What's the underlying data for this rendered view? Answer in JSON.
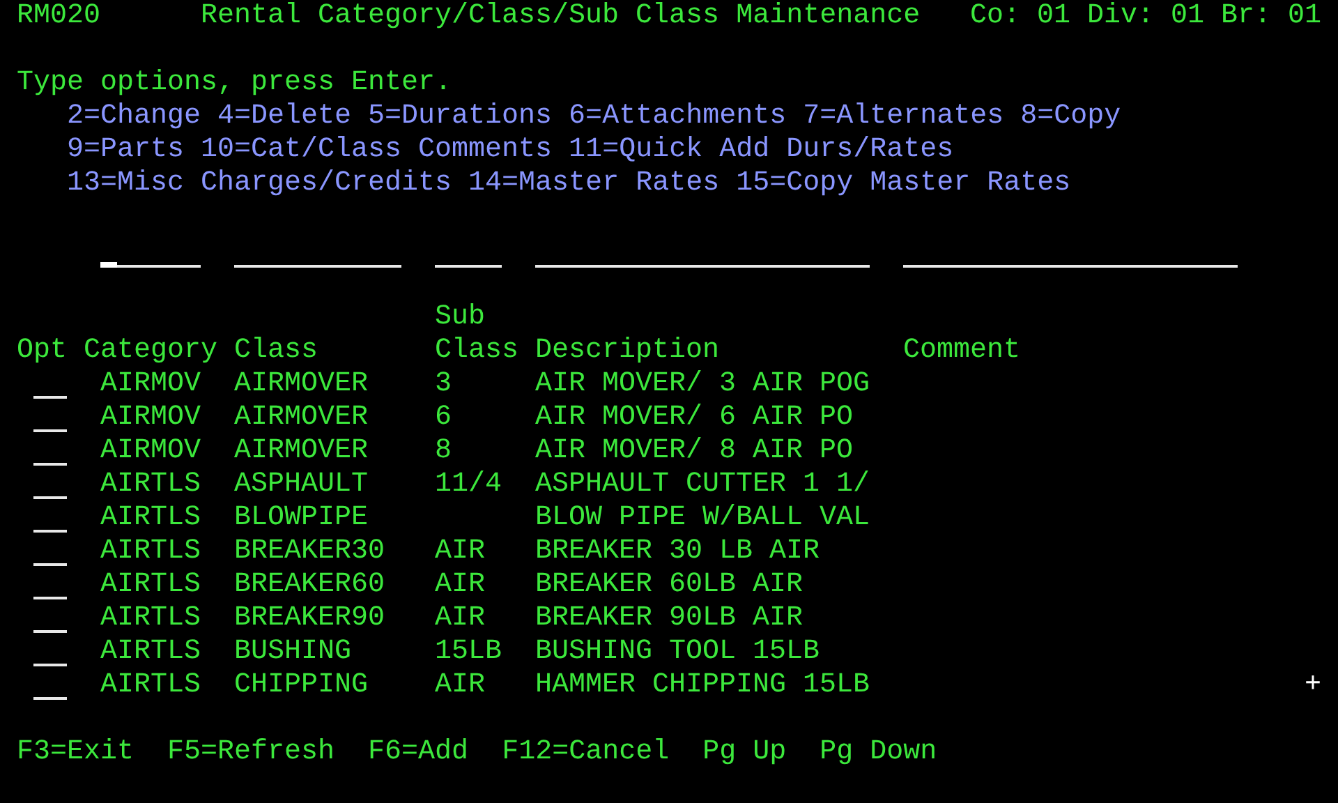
{
  "header": {
    "program": "RM020",
    "title": "Rental Category/Class/Sub Class Maintenance",
    "location": "Co: 01 Div: 01 Br: 01"
  },
  "instructions": "Type options, press Enter.",
  "option_lines": [
    "2=Change 4=Delete 5=Durations 6=Attachments 7=Alternates 8=Copy",
    "9=Parts 10=Cat/Class Comments 11=Quick Add Durs/Rates",
    "13=Misc Charges/Credits 14=Master Rates 15=Copy Master Rates"
  ],
  "filters": [
    {
      "focused": true
    },
    {
      "focused": false
    },
    {
      "focused": false
    },
    {
      "focused": false
    },
    {
      "focused": false
    }
  ],
  "table": {
    "columns": [
      "Opt",
      "Category",
      "Class",
      "Sub Class",
      "Description",
      "Comment"
    ],
    "rows": [
      {
        "category": "AIRMOV",
        "class": "AIRMOVER",
        "sub_class": "3",
        "description": "AIR MOVER/ 3 AIR POG"
      },
      {
        "category": "AIRMOV",
        "class": "AIRMOVER",
        "sub_class": "6",
        "description": "AIR MOVER/ 6 AIR PO"
      },
      {
        "category": "AIRMOV",
        "class": "AIRMOVER",
        "sub_class": "8",
        "description": "AIR MOVER/ 8 AIR PO"
      },
      {
        "category": "AIRTLS",
        "class": "ASPHAULT",
        "sub_class": "11/4",
        "description": "ASPHAULT CUTTER 1 1/"
      },
      {
        "category": "AIRTLS",
        "class": "BLOWPIPE",
        "description": "BLOW PIPE W/BALL VAL"
      },
      {
        "category": "AIRTLS",
        "class": "BREAKER30",
        "sub_class": "AIR",
        "description": "BREAKER 30 LB AIR"
      },
      {
        "category": "AIRTLS",
        "class": "BREAKER60",
        "sub_class": "AIR",
        "description": "BREAKER 60LB AIR"
      },
      {
        "category": "AIRTLS",
        "class": "BREAKER90",
        "sub_class": "AIR",
        "description": "BREAKER 90LB AIR"
      },
      {
        "category": "AIRTLS",
        "class": "BUSHING",
        "sub_class": "15LB",
        "description": "BUSHING TOOL 15LB"
      },
      {
        "category": "AIRTLS",
        "class": "CHIPPING",
        "sub_class": "AIR",
        "description": "HAMMER CHIPPING 15LB"
      }
    ],
    "more": "+"
  },
  "function_keys": [
    "F3=Exit",
    "F5=Refresh",
    "F6=Add",
    "F12=Cancel",
    "Pg Up",
    "Pg Down"
  ]
}
